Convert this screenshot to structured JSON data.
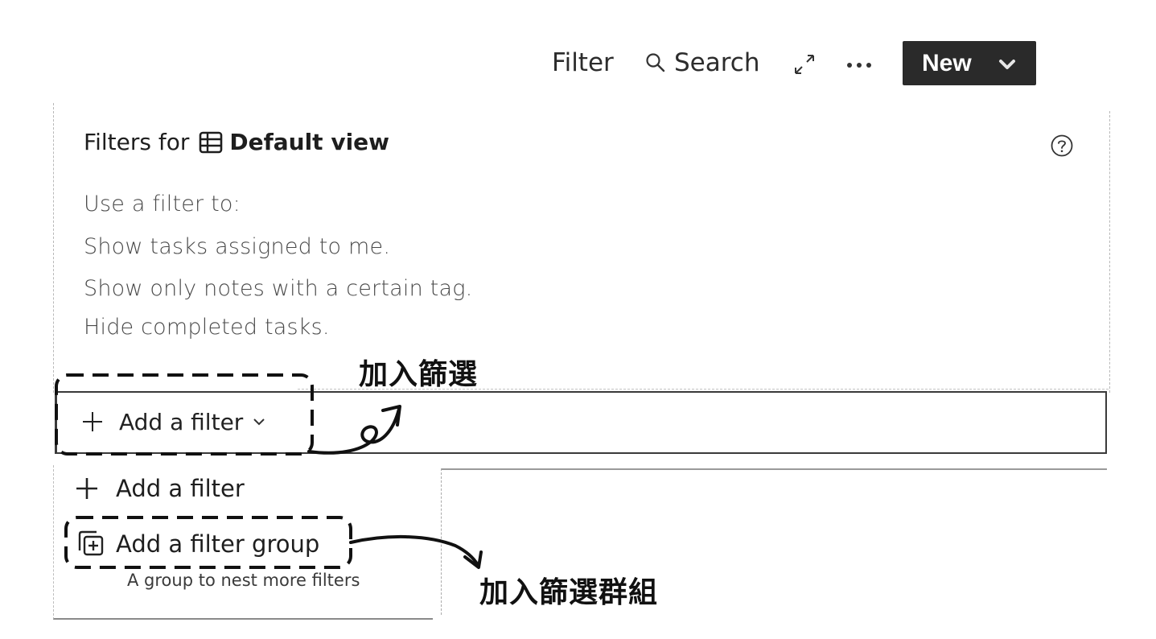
{
  "toolbar": {
    "filter_label": "Filter",
    "search_label": "Search",
    "new_label": "New",
    "icons": [
      "search-icon",
      "expand-icon",
      "more-icon",
      "chevron-down-icon"
    ]
  },
  "panel": {
    "title_prefix": "Filters for",
    "view_name": "Default view",
    "view_icon": "table-icon",
    "help_icon": "help-icon",
    "description": [
      "Use a filter to:",
      "Show tasks assigned to me.",
      "Show only notes with a certain tag.",
      "Hide completed tasks."
    ],
    "add_filter_button": "Add a filter"
  },
  "menu": {
    "items": [
      {
        "label": "Add a filter",
        "icon": "plus-icon"
      },
      {
        "label": "Add a filter group",
        "icon": "filter-group-icon",
        "description": "A group to nest more filters"
      }
    ]
  },
  "annotations": {
    "add_filter": "加入篩選",
    "add_filter_group": "加入篩選群組"
  },
  "colors": {
    "new_button_bg": "#2a2a2a",
    "text": "#222222"
  }
}
